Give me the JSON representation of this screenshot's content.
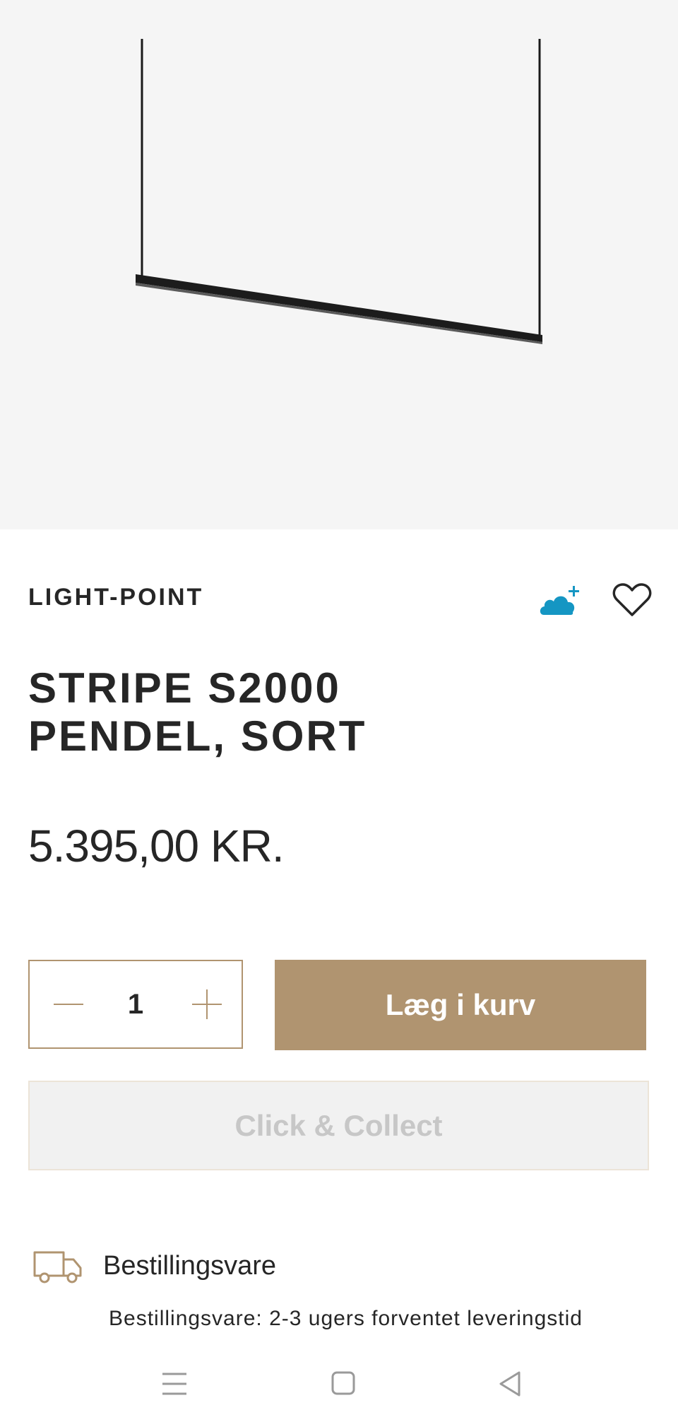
{
  "product": {
    "brand": "LIGHT-POINT",
    "title_line1": "STRIPE S2000",
    "title_line2": "PENDEL, SORT",
    "price": "5.395,00 KR.",
    "image_alt": "Stripe S2000 pendel"
  },
  "icons": {
    "save": "cloud-plus-icon",
    "wishlist": "heart-icon",
    "delivery": "truck-icon"
  },
  "quantity": {
    "value": "1"
  },
  "actions": {
    "add_to_cart": "Læg i kurv",
    "click_collect": "Click & Collect"
  },
  "delivery": {
    "title": "Bestillingsvare",
    "text": "Bestillingsvare: 2-3 ugers forventet leveringstid"
  },
  "colors": {
    "accent": "#b09470",
    "cloud": "#1596c3",
    "text": "#262626",
    "disabled_text": "#c7c7c7",
    "hero_bg": "#f5f5f5"
  },
  "system_nav": {
    "icons": [
      "menu-icon",
      "home-icon",
      "back-icon"
    ]
  }
}
